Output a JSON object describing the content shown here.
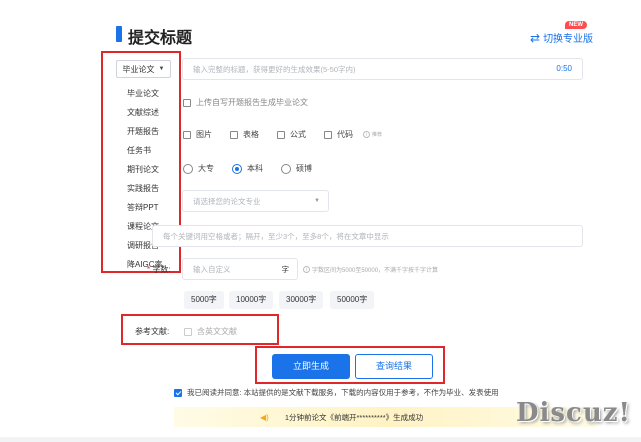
{
  "header": {
    "title": "提交标题",
    "switch_label": "切换专业版",
    "new_badge": "NEW"
  },
  "type_select": {
    "selected": "毕业论文",
    "options": [
      "毕业论文",
      "文献综述",
      "开题报告",
      "任务书",
      "期刊论文",
      "实践报告",
      "答辩PPT",
      "课程论文",
      "调研报告",
      "降AIGC率"
    ]
  },
  "title_input": {
    "placeholder": "输入完整的标题，获得更好的生成效果(5-50字内)",
    "counter": "0:50"
  },
  "upload_proposal": {
    "label": "上传自写开题报告生成毕业论文"
  },
  "content_options": {
    "items": [
      "图片",
      "表格",
      "公式",
      "代码"
    ],
    "hint": "推荐"
  },
  "degree": {
    "options": [
      "大专",
      "本科",
      "硕博"
    ],
    "selected": "本科"
  },
  "major_select": {
    "placeholder": "请选择您的论文专业"
  },
  "keywords_input": {
    "placeholder": "每个关键词用空格或者；隔开，至少3个，至多8个，将在文章中显示"
  },
  "word_count": {
    "label": "字数:",
    "placeholder": "输入自定义",
    "unit": "字",
    "hint": "字数区间为5000至50000，不满千字按千字计算",
    "presets": [
      "5000字",
      "10000字",
      "30000字",
      "50000字"
    ]
  },
  "references": {
    "label": "参考文献:",
    "option": "含英文文献"
  },
  "actions": {
    "generate": "立即生成",
    "query": "查询结果"
  },
  "agreement": {
    "text": "我已阅读并同意: 本站提供的是文献下载服务，下载的内容仅用于参考，不作为毕业、发表使用"
  },
  "notice": {
    "time": "1分钟前",
    "message": "论文《前端开**********》生成成功"
  },
  "watermark": "Discuz!",
  "colors": {
    "accent": "#1a73e8",
    "highlight_border": "#e0282a",
    "badge": "#ff4d4f"
  }
}
